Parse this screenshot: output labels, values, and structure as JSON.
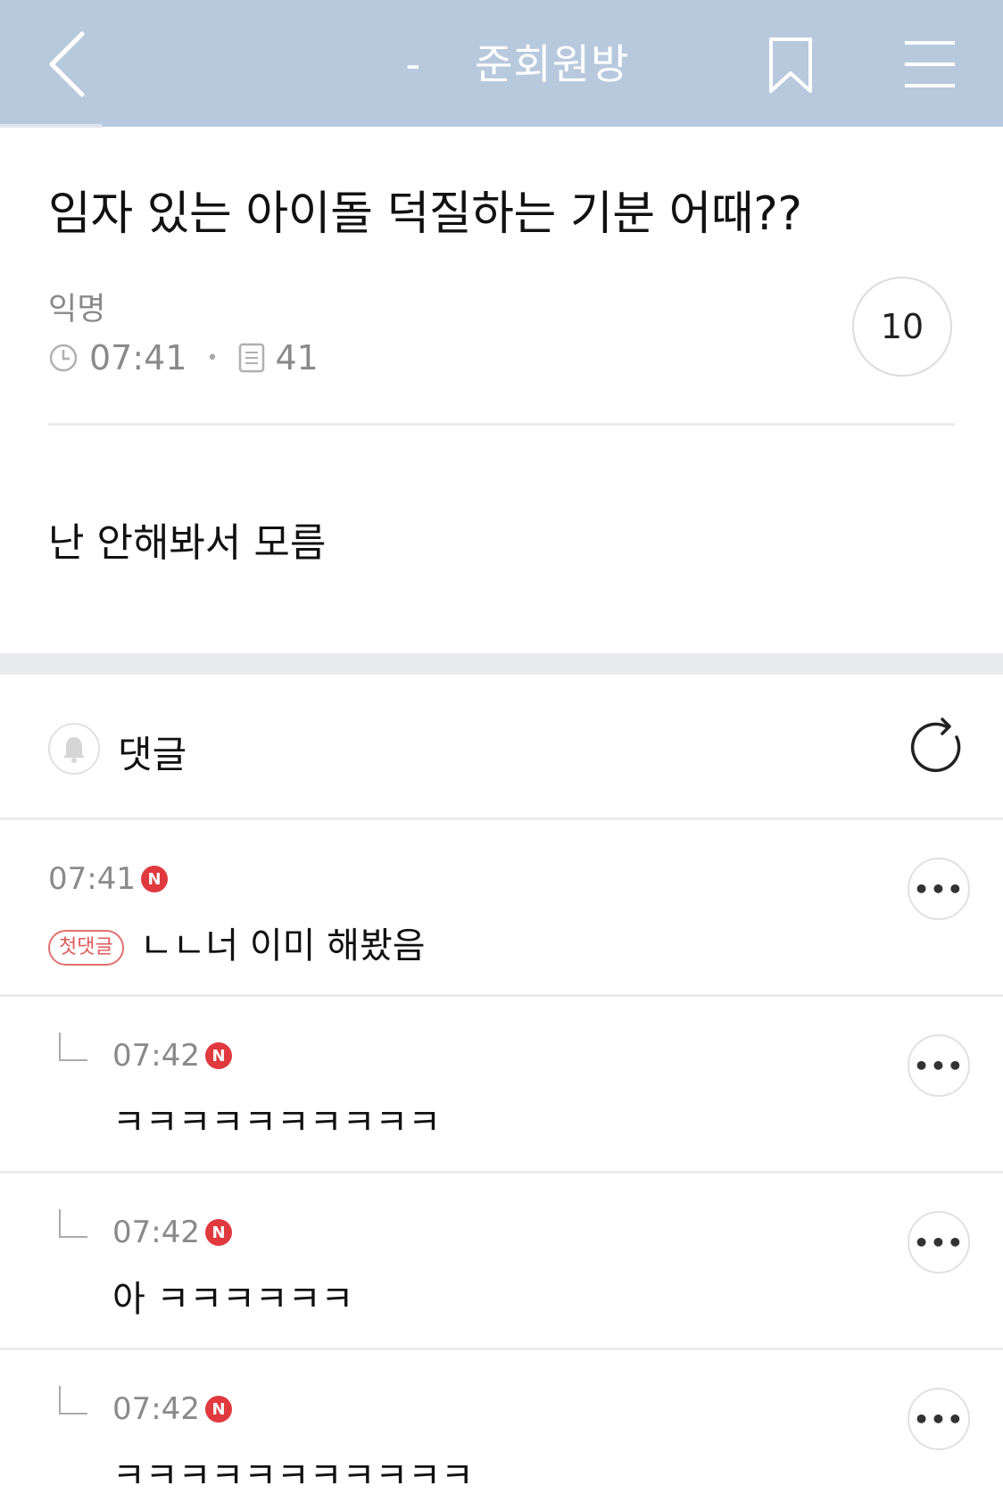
{
  "header": {
    "title_prefix": "-",
    "board_name": "준회원방"
  },
  "post": {
    "title": "임자 있는 아이돌 덕질하는 기분 어때??",
    "author": "익명",
    "time": "07:41",
    "views": "41",
    "comment_count": "10",
    "body": "난 안해봐서 모름"
  },
  "comments_section": {
    "label": "댓글"
  },
  "comments": [
    {
      "time": "07:41",
      "new_badge": "N",
      "first_badge": "첫댓글",
      "text": "ㄴㄴ너 이미 해봤음"
    },
    {
      "time": "07:42",
      "new_badge": "N",
      "text": "ㅋㅋㅋㅋㅋㅋㅋㅋㅋㅋ"
    },
    {
      "time": "07:42",
      "new_badge": "N",
      "text": "아 ㅋㅋㅋㅋㅋㅋ"
    },
    {
      "time": "07:42",
      "new_badge": "N",
      "text": "ㅋㅋㅋㅋㅋㅋㅋㅋㅋㅋㅋ"
    }
  ],
  "more_label": "•••",
  "icons": {
    "back": "chevron-left-icon",
    "bookmark": "bookmark-icon",
    "menu": "hamburger-menu-icon",
    "clock": "clock-icon",
    "views": "document-icon",
    "bell": "bell-icon",
    "refresh": "refresh-icon",
    "reply": "reply-arrow-icon"
  },
  "colors": {
    "header_bg": "#b8c9de",
    "new_badge": "#e0393e",
    "first_badge": "#e05a5a"
  }
}
